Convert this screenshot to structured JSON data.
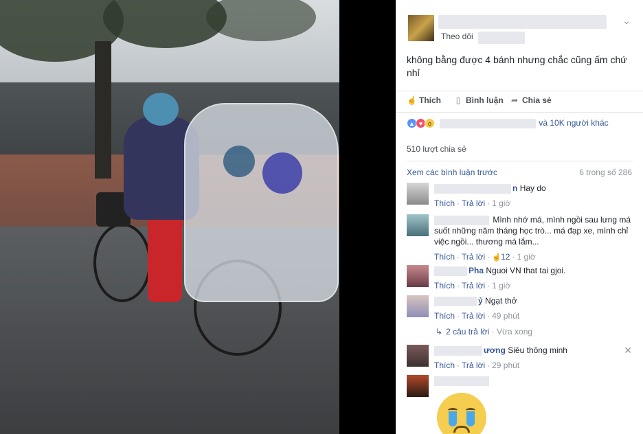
{
  "post": {
    "follow_label": "Theo dõi",
    "text": "không bằng được 4 bánh nhưng chắc cũng ấm chứ nhỉ"
  },
  "actions": {
    "like": "Thích",
    "comment": "Bình luận",
    "share": "Chia sẻ"
  },
  "reactions": {
    "others": "và 10K người khác",
    "icons": [
      "like-icon",
      "love-icon",
      "wow-icon"
    ]
  },
  "shares": "510 lượt chia sẻ",
  "comments_header": {
    "view_previous": "Xem các bình luận trước",
    "count": "6 trong số 286"
  },
  "comments": [
    {
      "name_suffix": "n",
      "text": "Hay do",
      "like": "Thích",
      "reply": "Trả lời",
      "time": "1 giờ"
    },
    {
      "name_suffix": "",
      "text": "Mình nhớ má, mình ngồi sau lưng má suốt những năm tháng học trò... má đạp xe, mình chỉ việc ngồi... thương má lắm...",
      "like": "Thích",
      "reply": "Trả lời",
      "likes": "12",
      "time": "1 giờ"
    },
    {
      "name_suffix": "Pha",
      "text": "Nguoi VN that tai gjoi.",
      "like": "Thích",
      "reply": "Trả lời",
      "time": "1 giờ"
    },
    {
      "name_suffix": "ỷ",
      "text": "Ngạt thở",
      "like": "Thích",
      "reply": "Trả lời",
      "time": "49 phút"
    },
    {
      "name_suffix": "ương",
      "text": "Siêu thông minh",
      "like": "Thích",
      "reply": "Trả lời",
      "time": "29 phút"
    },
    {
      "name_suffix": "",
      "text": "",
      "like": "",
      "reply": "",
      "time": ""
    }
  ],
  "replies_link": {
    "label": "2 câu trả lời",
    "time": "Vừa xong"
  },
  "colors": {
    "link": "#365899",
    "meta": "#90949c",
    "text": "#1d2129"
  }
}
